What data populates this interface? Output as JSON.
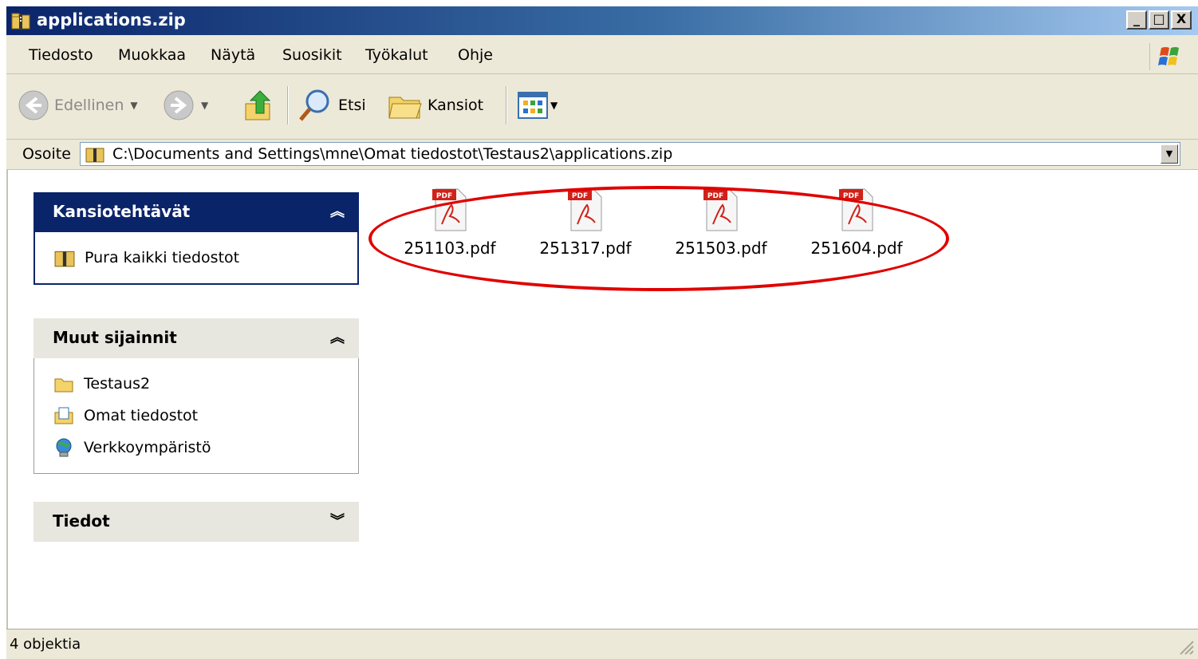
{
  "window": {
    "title": "applications.zip",
    "controls": {
      "minimize": "_",
      "maximize": "□",
      "close": "X"
    }
  },
  "menu": [
    {
      "label": "Tiedosto"
    },
    {
      "label": "Muokkaa"
    },
    {
      "label": "Näytä"
    },
    {
      "label": "Suosikit"
    },
    {
      "label": "Työkalut"
    },
    {
      "label": "Ohje"
    }
  ],
  "toolbar": {
    "back_label": "Edellinen",
    "search_label": "Etsi",
    "folders_label": "Kansiot"
  },
  "address": {
    "label": "Osoite",
    "path": "C:\\Documents and Settings\\mne\\Omat tiedostot\\Testaus2\\applications.zip"
  },
  "panels": {
    "folder_tasks": {
      "title": "Kansiotehtävät",
      "items": [
        {
          "label": "Pura kaikki tiedostot",
          "icon": "zip-folder-icon"
        }
      ]
    },
    "other_places": {
      "title": "Muut sijainnit",
      "items": [
        {
          "label": "Testaus2",
          "icon": "folder-icon"
        },
        {
          "label": "Omat tiedostot",
          "icon": "my-documents-icon"
        },
        {
          "label": "Verkkoympäristö",
          "icon": "network-icon"
        }
      ]
    },
    "details": {
      "title": "Tiedot"
    }
  },
  "files": [
    {
      "name": "251103.pdf",
      "icon": "pdf-icon"
    },
    {
      "name": "251317.pdf",
      "icon": "pdf-icon"
    },
    {
      "name": "251503.pdf",
      "icon": "pdf-icon"
    },
    {
      "name": "251604.pdf",
      "icon": "pdf-icon"
    }
  ],
  "status": {
    "text": "4 objektia"
  },
  "colors": {
    "title_bar": "#0a246a",
    "panel_header": "#0a246a",
    "highlight_ellipse": "#e00000"
  }
}
